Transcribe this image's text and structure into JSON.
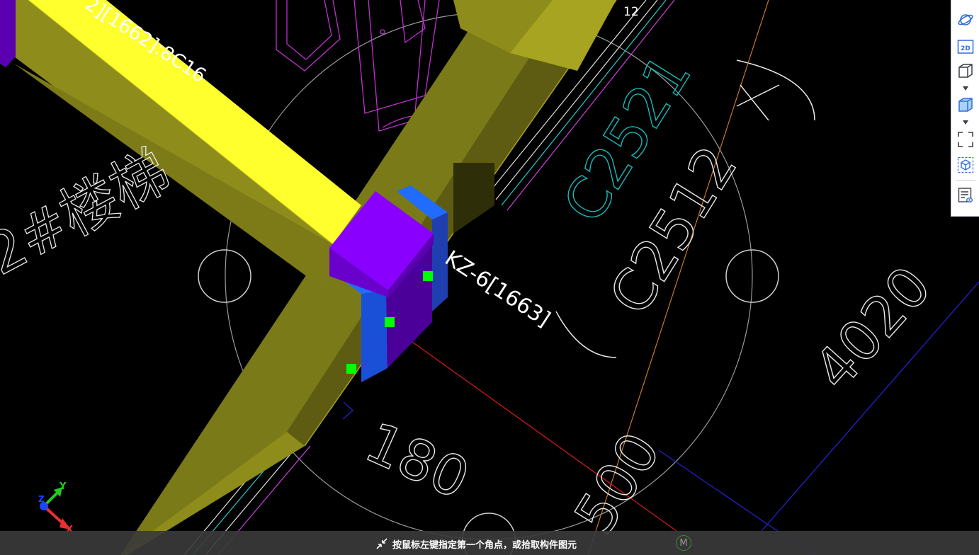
{
  "viewport": {
    "labels": {
      "beam_label": "2][1662]:8C16",
      "column_label": "KZ-6[1663]",
      "dim_c2521": "C2521",
      "dim_c2512": "C2512",
      "dim_4020": "4020",
      "dim_180": "180",
      "dim_500": "500",
      "grid_number": "12",
      "stair_text": "2#楼梯"
    },
    "axis_triad": {
      "x_label": "X",
      "y_label": "Y",
      "z_label": "Z"
    },
    "colors": {
      "background": "#000000",
      "beam_top": "#ffff2e",
      "beam_side": "#8e8c1a",
      "column_top": "#8a00ff",
      "column_side": "#4a0099",
      "column_end": "#1f6cff",
      "grip": "#00ff00",
      "cad_lines": "#ffffff",
      "cyan_text": "#1ab8b8",
      "magenta_lines": "#c030d0"
    }
  },
  "toolbar": {
    "items": [
      {
        "name": "orbit-icon"
      },
      {
        "name": "view-2d-icon",
        "text": "2D"
      },
      {
        "name": "view-3d-box-icon"
      },
      {
        "name": "dropdown-caret-icon"
      },
      {
        "name": "view-3d-solid-icon"
      },
      {
        "name": "dropdown-caret-icon"
      },
      {
        "name": "zoom-extents-icon"
      },
      {
        "name": "dynamic-observe-icon"
      },
      {
        "name": "properties-view-icon"
      }
    ]
  },
  "status": {
    "hint": "按鼠标左键指定第一个角点，或拾取构件图元",
    "mode_badge": "M"
  }
}
